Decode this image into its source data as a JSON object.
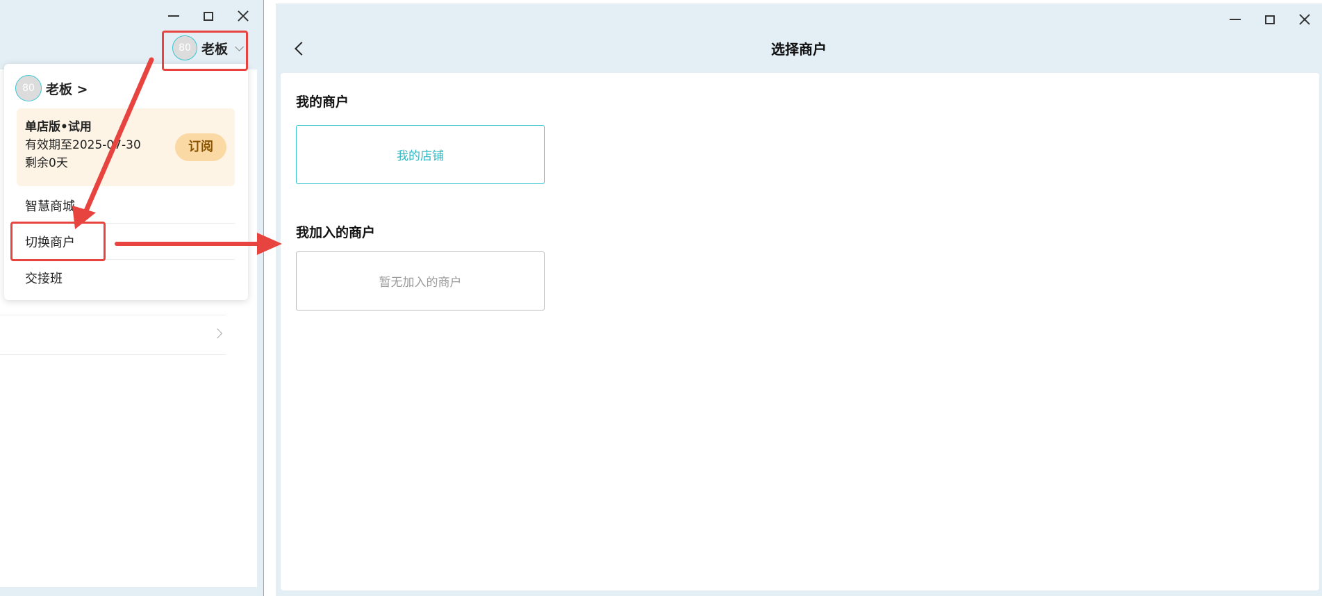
{
  "left_window": {
    "user": {
      "avatar_text": "80",
      "name": "老板"
    },
    "menu": {
      "user_label": "老板 >",
      "plan": {
        "title": "单店版•试用",
        "expiry": "有效期至2025-07-30",
        "remaining": "剩余0天",
        "subscribe_label": "订阅"
      },
      "items": [
        {
          "label": "智慧商城"
        },
        {
          "label": "切换商户"
        },
        {
          "label": "交接班"
        }
      ]
    }
  },
  "right_window": {
    "title": "选择商户",
    "sections": {
      "mine": {
        "title": "我的商户",
        "card": "我的店铺"
      },
      "joined": {
        "title": "我加入的商户",
        "empty": "暂无加入的商户"
      }
    }
  },
  "colors": {
    "accent": "#3cc6cf",
    "highlight": "#e8443f",
    "window_bg": "#e3eef5",
    "plan_bg": "#fdf4e6",
    "subscribe_bg": "#fbd9a4"
  }
}
